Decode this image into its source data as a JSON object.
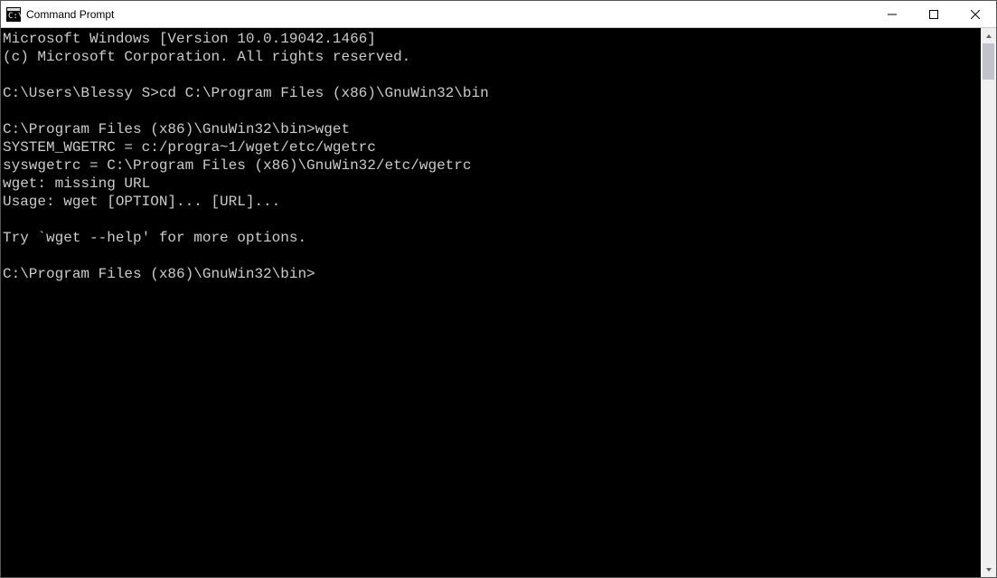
{
  "window": {
    "title": "Command Prompt"
  },
  "terminal": {
    "lines": [
      "Microsoft Windows [Version 10.0.19042.1466]",
      "(c) Microsoft Corporation. All rights reserved.",
      "",
      "C:\\Users\\Blessy S>cd C:\\Program Files (x86)\\GnuWin32\\bin",
      "",
      "C:\\Program Files (x86)\\GnuWin32\\bin>wget",
      "SYSTEM_WGETRC = c:/progra~1/wget/etc/wgetrc",
      "syswgetrc = C:\\Program Files (x86)\\GnuWin32/etc/wgetrc",
      "wget: missing URL",
      "Usage: wget [OPTION]... [URL]...",
      "",
      "Try `wget --help' for more options.",
      "",
      "C:\\Program Files (x86)\\GnuWin32\\bin>"
    ]
  }
}
